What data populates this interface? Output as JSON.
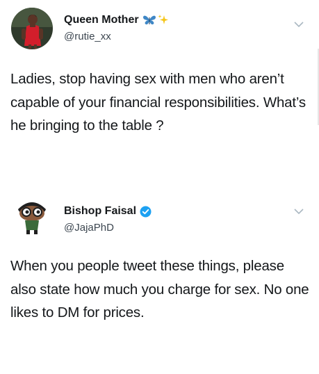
{
  "tweets": [
    {
      "display_name": "Queen Mother",
      "handle": "@rutie_xx",
      "name_icons": [
        "butterfly-emoji",
        "sparkles-emoji"
      ],
      "text": "Ladies, stop having sex with men who aren’t capable of your financial responsibilities. What’s he bringing to the table ?"
    },
    {
      "display_name": "Bishop Faisal",
      "handle": "@JajaPhD",
      "verified": true,
      "text": "When you people tweet these things, please also state how much you charge for sex. No one likes to DM for prices."
    }
  ],
  "colors": {
    "text": "#14171a",
    "secondary_text": "#3c4650",
    "verified_blue": "#1da1f2",
    "chevron": "#aab8c2"
  }
}
